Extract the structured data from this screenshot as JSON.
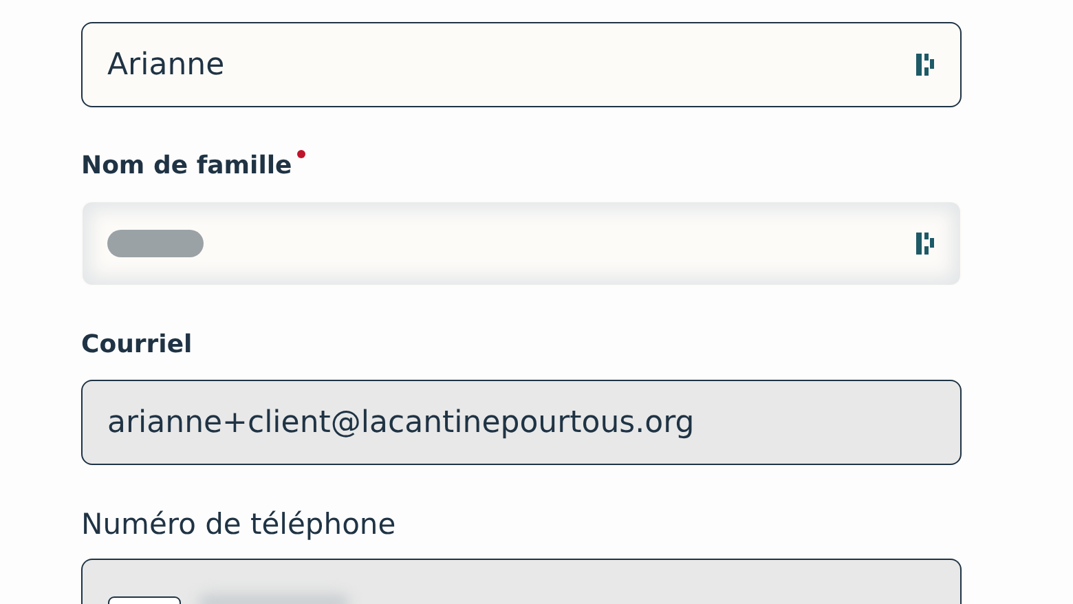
{
  "fields": [
    {
      "kind": "text",
      "value": "Arianne",
      "disabled": false,
      "redacted": false,
      "autofill_icon": true
    },
    {
      "kind": "text",
      "label": "Nom de famille",
      "required": true,
      "disabled": false,
      "redacted": true,
      "autofill_icon": true
    },
    {
      "kind": "text",
      "label": "Courriel",
      "required": false,
      "value": "arianne+client@lacantinepourtous.org",
      "disabled": true,
      "redacted": false,
      "autofill_icon": false
    },
    {
      "kind": "phone",
      "label": "Numéro de téléphone",
      "required": false,
      "disabled": true,
      "redacted": true,
      "autofill_icon": false
    }
  ]
}
